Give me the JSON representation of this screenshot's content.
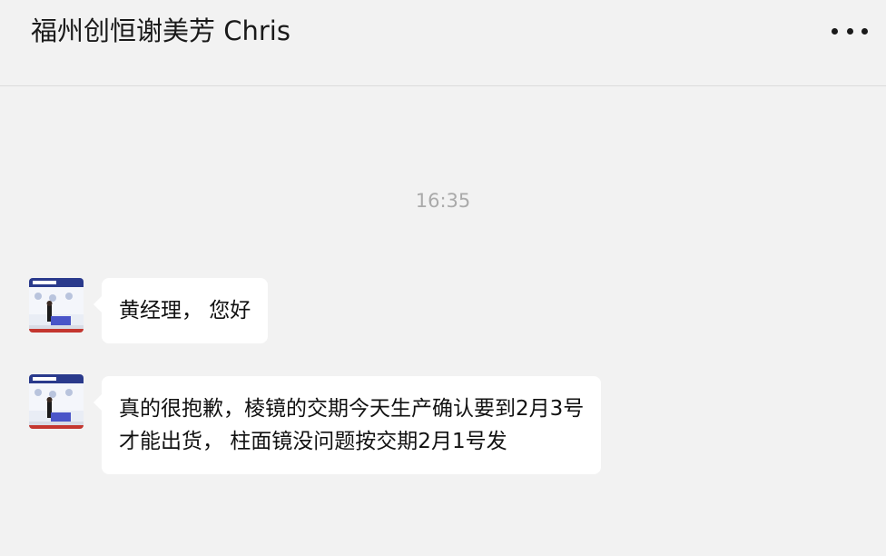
{
  "header": {
    "title": "福州创恒谢美芳 Chris",
    "more_icon": "more-dots-icon"
  },
  "timestamp": "16:35",
  "messages": [
    {
      "avatar": "sender-avatar",
      "lines": [
        "黄经理， 您好"
      ]
    },
    {
      "avatar": "sender-avatar",
      "lines": [
        "真的很抱歉，棱镜的交期今天生产确认要到2月3号",
        "才能出货， 柱面镜没问题按交期2月1号发"
      ]
    }
  ],
  "colors": {
    "background": "#f2f2f2",
    "bubble": "#ffffff",
    "timestamp": "#aaaaaa",
    "text": "#111111"
  }
}
